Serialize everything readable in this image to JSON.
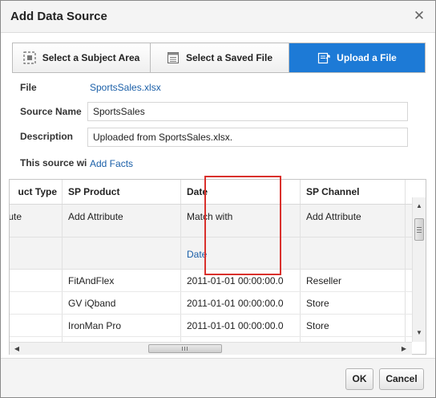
{
  "dialog": {
    "title": "Add Data Source",
    "close_icon": "close-icon"
  },
  "tabs": [
    {
      "label": "Select a Subject Area",
      "icon": "subject-area-icon",
      "active": false
    },
    {
      "label": "Select a Saved File",
      "icon": "saved-file-icon",
      "active": false
    },
    {
      "label": "Upload a File",
      "icon": "upload-file-icon",
      "active": true
    }
  ],
  "form": {
    "file_label": "File",
    "file_value": "SportsSales.xlsx",
    "source_name_label": "Source Name",
    "source_name_value": "SportsSales",
    "description_label": "Description",
    "description_value": "Uploaded from SportsSales.xlsx.",
    "this_source_label": "This source wi",
    "add_facts_link": "Add Facts"
  },
  "grid": {
    "columns": [
      "uct Type",
      "SP Product",
      "Date",
      "SP Channel"
    ],
    "attribute_row": [
      "ute",
      "Add Attribute",
      "Match with",
      "Add Attribute"
    ],
    "match_row": [
      "",
      "",
      "Date",
      ""
    ],
    "rows": [
      [
        "",
        "FitAndFlex",
        "2011-01-01 00:00:00.0",
        "Reseller"
      ],
      [
        "",
        "GV iQband",
        "2011-01-01 00:00:00.0",
        "Store"
      ],
      [
        "",
        "IronMan Pro",
        "2011-01-01 00:00:00.0",
        "Store"
      ],
      [
        "",
        "",
        "",
        ""
      ]
    ]
  },
  "footer": {
    "ok_label": "OK",
    "cancel_label": "Cancel"
  },
  "colors": {
    "accent": "#1d7ad6",
    "link": "#1a5fa8",
    "highlight": "#d9302c"
  }
}
